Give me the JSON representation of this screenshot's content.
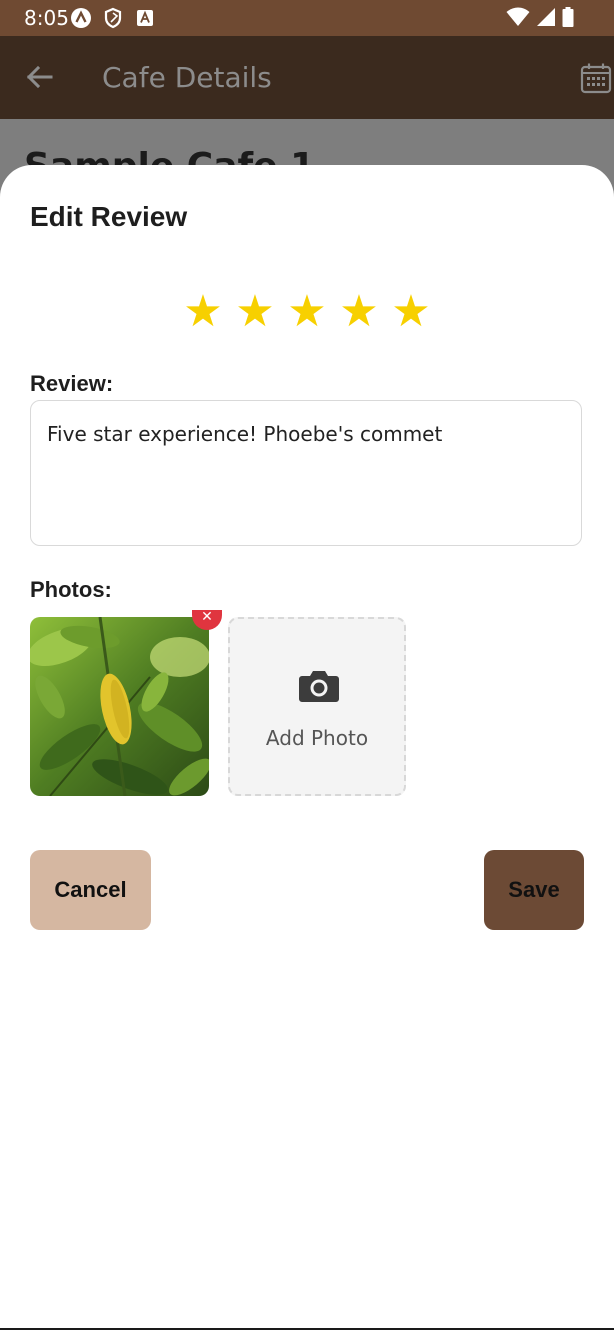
{
  "status_bar": {
    "time": "8:05",
    "icons": [
      "app-icon-a",
      "shield-icon",
      "text-icon",
      "wifi-icon",
      "signal-icon",
      "battery-icon"
    ]
  },
  "app_bar": {
    "title": "Cafe Details",
    "back_icon": "arrow-left-icon",
    "action_icon": "calendar-icon"
  },
  "background_page": {
    "title": "Sample Cafe 1"
  },
  "sheet": {
    "title": "Edit Review",
    "rating": {
      "value": 5,
      "max": 5,
      "star_glyph": "★",
      "color": "#f7d000"
    },
    "review_label": "Review:",
    "review_text": "Five star experience! Phoebe's commet",
    "photos_label": "Photos:",
    "photo_remove_glyph": "✕",
    "add_photo_label": "Add Photo",
    "cancel_label": "Cancel",
    "save_label": "Save"
  },
  "colors": {
    "status_bar": "#6f4a32",
    "app_bar": "#3b2a1e",
    "cancel": "#d5b7a1",
    "save": "#6c4a35",
    "remove": "#e0353f"
  }
}
